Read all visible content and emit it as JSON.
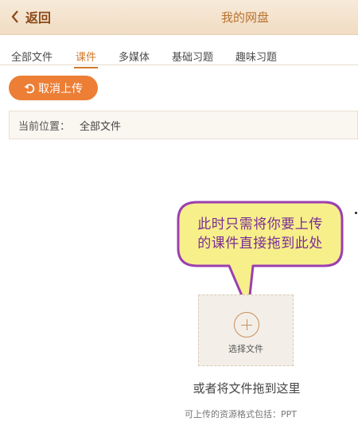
{
  "header": {
    "back_label": "返回",
    "title": "我的网盘"
  },
  "tabs": [
    {
      "label": "全部文件"
    },
    {
      "label": "课件"
    },
    {
      "label": "多媒体"
    },
    {
      "label": "基础习题"
    },
    {
      "label": "趣味习题"
    }
  ],
  "active_tab": "课件",
  "actions": {
    "cancel_upload_label": "取消上传"
  },
  "location": {
    "label": "当前位置：",
    "path": "全部文件"
  },
  "callout": {
    "line1": "此时只需将你要上传",
    "line2": "的课件直接拖到此处"
  },
  "upload": {
    "select_label": "选择文件",
    "drag_text": "或者将文件拖到这里",
    "formats_text": "可上传的资源格式包括：PPT"
  },
  "colors": {
    "accent": "#ec7e35",
    "active_tab": "#d07a2c",
    "callout_fill": "#f7ef8a",
    "callout_border": "#9c3fb0"
  }
}
